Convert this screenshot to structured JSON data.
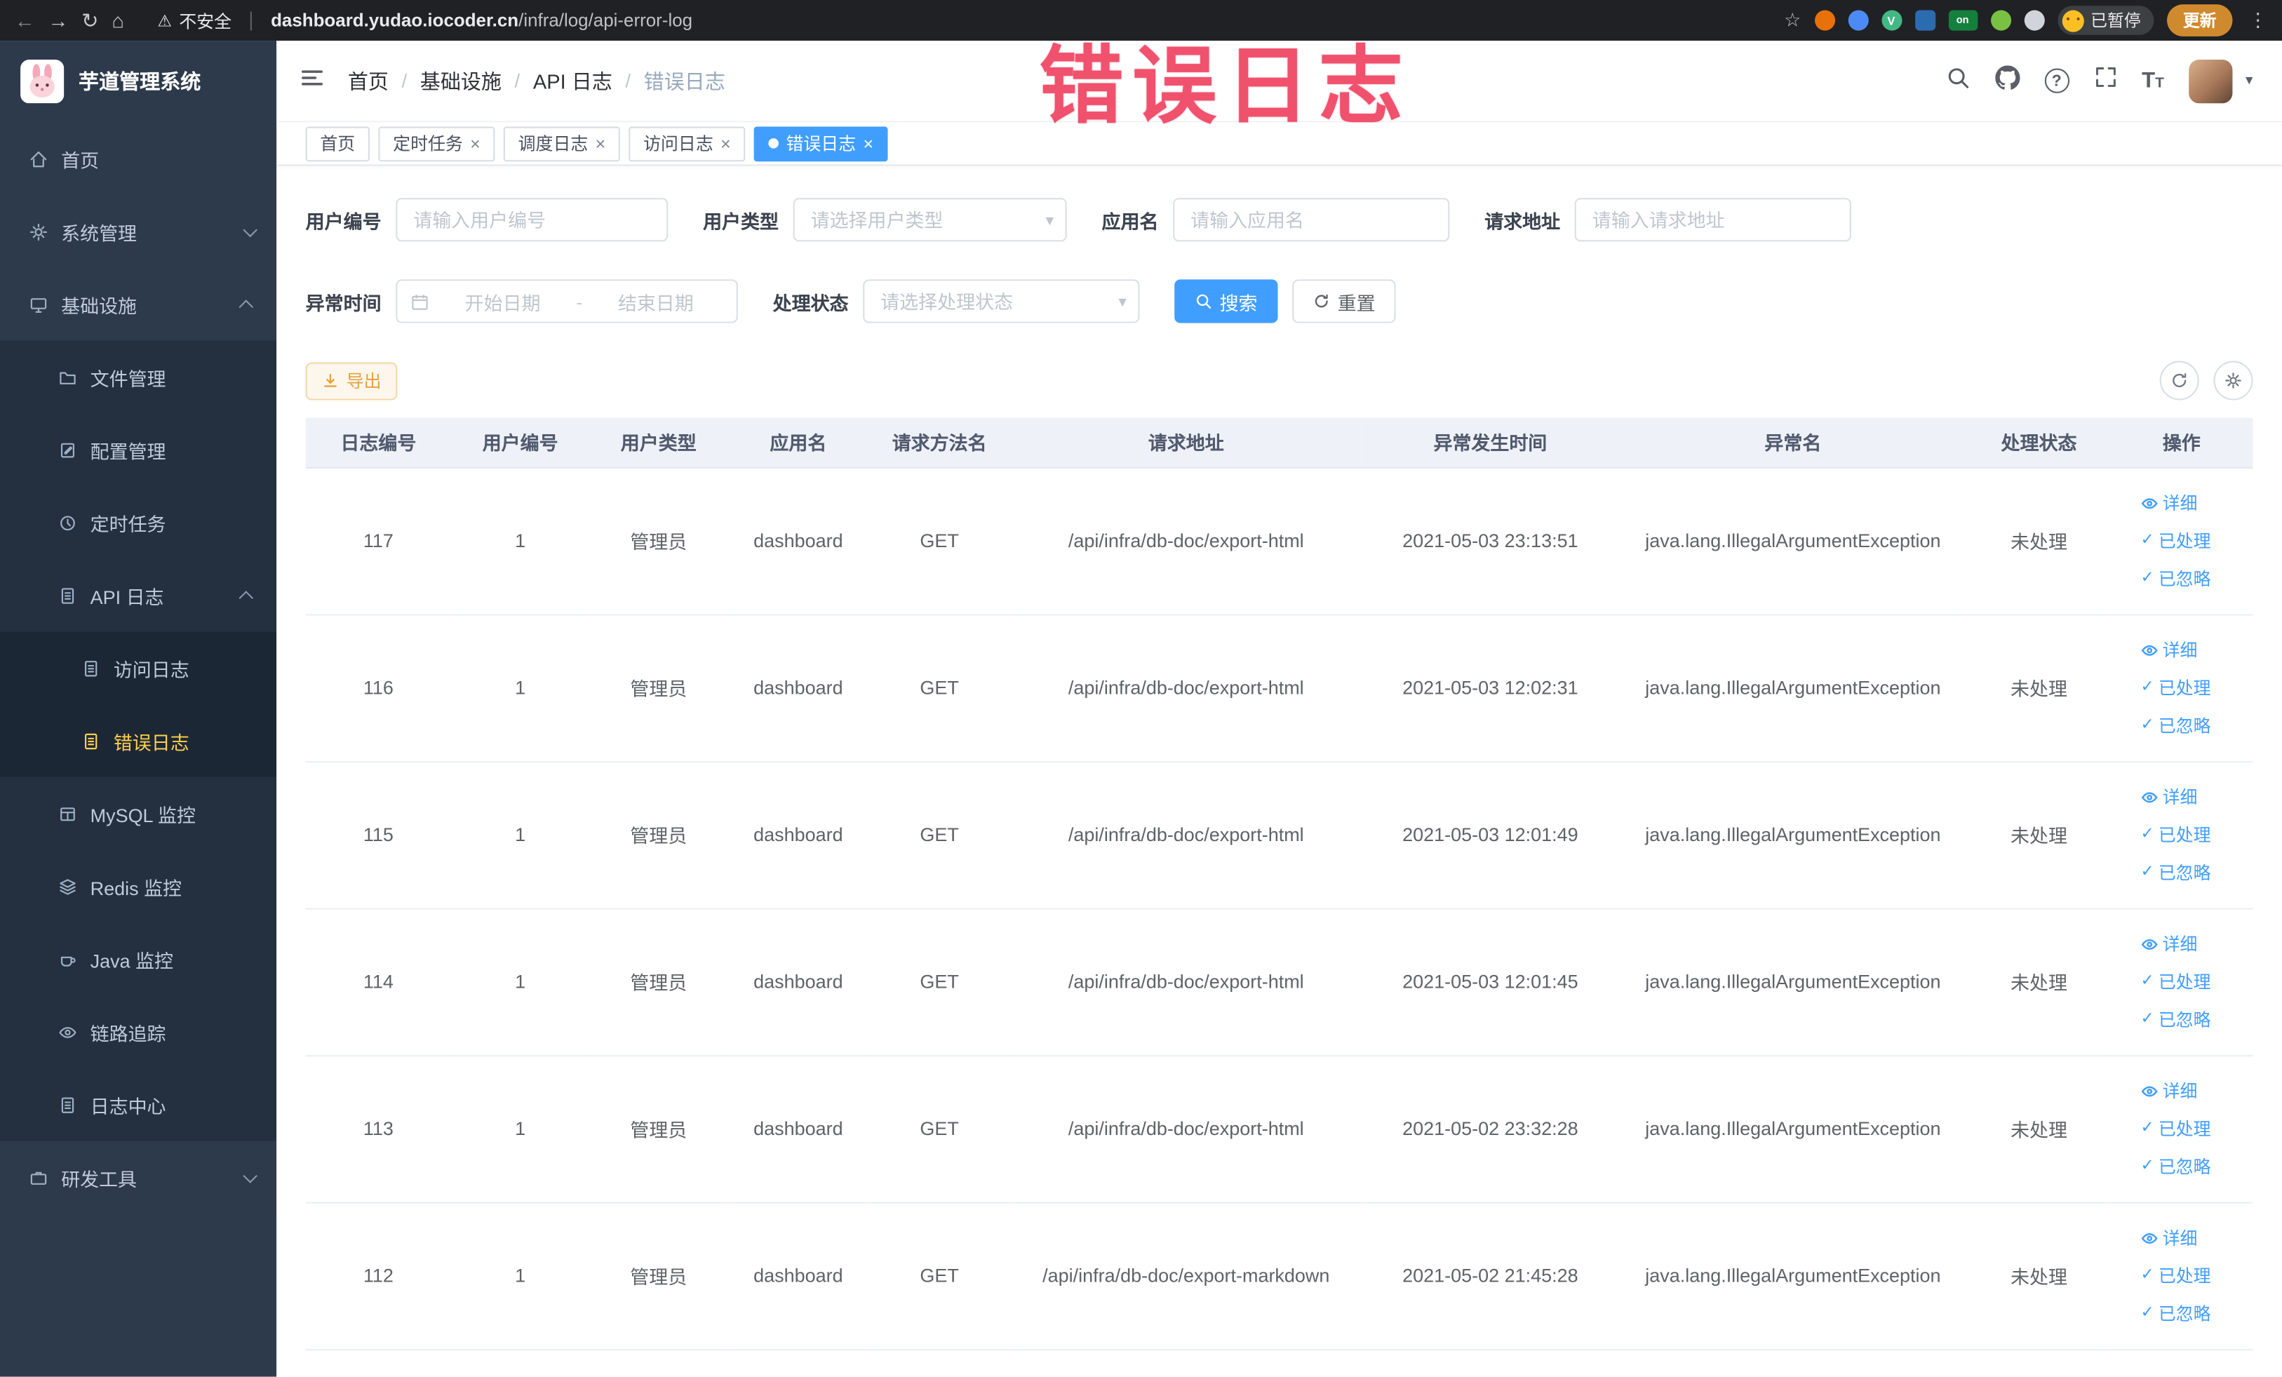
{
  "browser": {
    "security_label": "不安全",
    "url_host": "dashboard.yudao.iocoder.cn",
    "url_path": "/infra/log/api-error-log",
    "profile_label": "已暂停",
    "update_label": "更新"
  },
  "icons": {
    "back": "←",
    "forward": "→",
    "reload": "↻",
    "home": "⌂",
    "warning": "⚠",
    "star": "☆",
    "more": "⋮",
    "close": "×",
    "caret_down": "▾",
    "check": "✓",
    "question": "?",
    "font_size_big": "T",
    "font_size_small": "T",
    "ext_on": "on",
    "ext_v": "V"
  },
  "watermark": "错误日志",
  "sidebar": {
    "logo_title": "芋道管理系统",
    "items": [
      {
        "label": "首页"
      },
      {
        "label": "系统管理"
      },
      {
        "label": "基础设施"
      },
      {
        "label": "文件管理"
      },
      {
        "label": "配置管理"
      },
      {
        "label": "定时任务"
      },
      {
        "label": "API 日志"
      },
      {
        "label": "访问日志"
      },
      {
        "label": "错误日志"
      },
      {
        "label": "MySQL 监控"
      },
      {
        "label": "Redis 监控"
      },
      {
        "label": "Java 监控"
      },
      {
        "label": "链路追踪"
      },
      {
        "label": "日志中心"
      },
      {
        "label": "研发工具"
      }
    ]
  },
  "breadcrumb": {
    "separator": "/",
    "items": [
      "首页",
      "基础设施",
      "API 日志",
      "错误日志"
    ]
  },
  "tabs": [
    {
      "label": "首页"
    },
    {
      "label": "定时任务"
    },
    {
      "label": "调度日志"
    },
    {
      "label": "访问日志"
    },
    {
      "label": "错误日志"
    }
  ],
  "filters": {
    "user_id": {
      "label": "用户编号",
      "placeholder": "请输入用户编号"
    },
    "user_type": {
      "label": "用户类型",
      "placeholder": "请选择用户类型"
    },
    "app_name": {
      "label": "应用名",
      "placeholder": "请输入应用名"
    },
    "request_url": {
      "label": "请求地址",
      "placeholder": "请输入请求地址"
    },
    "exception_time": {
      "label": "异常时间",
      "start_placeholder": "开始日期",
      "separator": "-",
      "end_placeholder": "结束日期"
    },
    "process_status": {
      "label": "处理状态",
      "placeholder": "请选择处理状态"
    },
    "search_label": "搜索",
    "reset_label": "重置"
  },
  "toolbar": {
    "export_label": "导出"
  },
  "table": {
    "columns": [
      "日志编号",
      "用户编号",
      "用户类型",
      "应用名",
      "请求方法名",
      "请求地址",
      "异常发生时间",
      "异常名",
      "处理状态",
      "操作"
    ],
    "actions": [
      {
        "label": "详细"
      },
      {
        "label": "已处理"
      },
      {
        "label": "已忽略"
      }
    ],
    "rows": [
      {
        "id": "117",
        "user_id": "1",
        "user_type": "管理员",
        "app": "dashboard",
        "method": "GET",
        "url": "/api/infra/db-doc/export-html",
        "time": "2021-05-03 23:13:51",
        "exception": "java.lang.IllegalArgumentException",
        "status": "未处理"
      },
      {
        "id": "116",
        "user_id": "1",
        "user_type": "管理员",
        "app": "dashboard",
        "method": "GET",
        "url": "/api/infra/db-doc/export-html",
        "time": "2021-05-03 12:02:31",
        "exception": "java.lang.IllegalArgumentException",
        "status": "未处理"
      },
      {
        "id": "115",
        "user_id": "1",
        "user_type": "管理员",
        "app": "dashboard",
        "method": "GET",
        "url": "/api/infra/db-doc/export-html",
        "time": "2021-05-03 12:01:49",
        "exception": "java.lang.IllegalArgumentException",
        "status": "未处理"
      },
      {
        "id": "114",
        "user_id": "1",
        "user_type": "管理员",
        "app": "dashboard",
        "method": "GET",
        "url": "/api/infra/db-doc/export-html",
        "time": "2021-05-03 12:01:45",
        "exception": "java.lang.IllegalArgumentException",
        "status": "未处理"
      },
      {
        "id": "113",
        "user_id": "1",
        "user_type": "管理员",
        "app": "dashboard",
        "method": "GET",
        "url": "/api/infra/db-doc/export-html",
        "time": "2021-05-02 23:32:28",
        "exception": "java.lang.IllegalArgumentException",
        "status": "未处理"
      },
      {
        "id": "112",
        "user_id": "1",
        "user_type": "管理员",
        "app": "dashboard",
        "method": "GET",
        "url": "/api/infra/db-doc/export-markdown",
        "time": "2021-05-02 21:45:28",
        "exception": "java.lang.IllegalArgumentException",
        "status": "未处理"
      }
    ]
  }
}
